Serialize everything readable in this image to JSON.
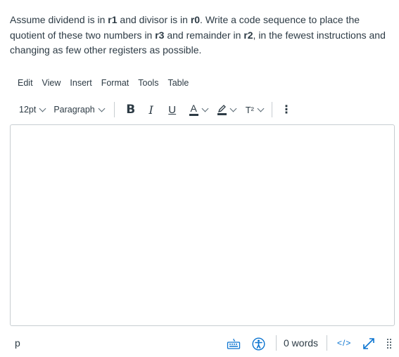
{
  "question": {
    "segments": [
      {
        "text": "Assume dividend is in ",
        "bold": false
      },
      {
        "text": "r1",
        "bold": true
      },
      {
        "text": " and divisor is in ",
        "bold": false
      },
      {
        "text": "r0",
        "bold": true
      },
      {
        "text": ". Write a code sequence to place the quotient of these two numbers in ",
        "bold": false
      },
      {
        "text": "r3",
        "bold": true
      },
      {
        "text": " and remainder in ",
        "bold": false
      },
      {
        "text": "r2",
        "bold": true
      },
      {
        "text": ", in the fewest instructions and changing as few other registers as possible.",
        "bold": false
      }
    ]
  },
  "menubar": {
    "items": [
      "Edit",
      "View",
      "Insert",
      "Format",
      "Tools",
      "Table"
    ]
  },
  "toolbar": {
    "font_size": "12pt",
    "block_format": "Paragraph",
    "bold_glyph": "B",
    "italic_glyph": "I",
    "underline_glyph": "U",
    "text_color_glyph": "A",
    "superscript_glyph": "T²",
    "more_glyph": "⋮"
  },
  "editor": {
    "content": ""
  },
  "statusbar": {
    "path": "p",
    "word_count": "0 words",
    "html_toggle": "</>"
  },
  "colors": {
    "text": "#2d3b45",
    "accent": "#0b74d0",
    "border": "#c7cdd1"
  }
}
